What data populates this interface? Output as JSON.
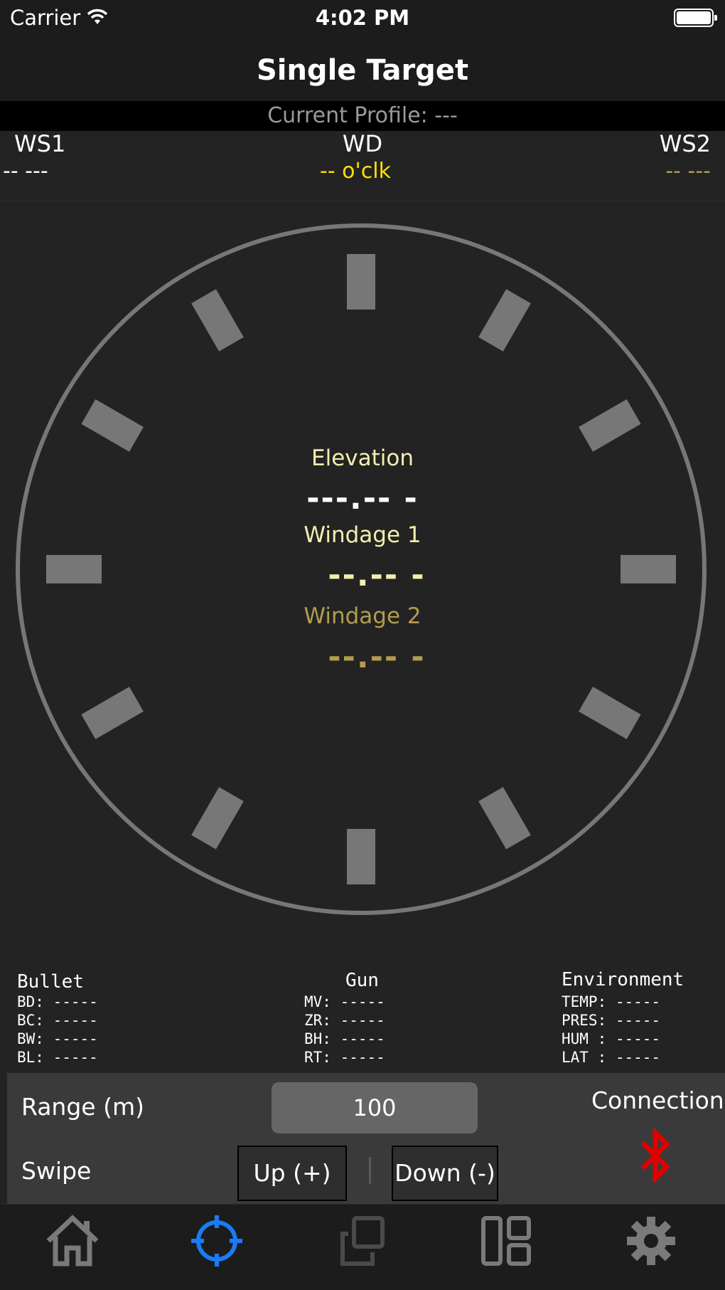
{
  "status": {
    "carrier": "Carrier",
    "time": "4:02 PM"
  },
  "nav": {
    "title": "Single Target"
  },
  "profile": {
    "text": "Current Profile: ---"
  },
  "wind": {
    "ws1_label": "WS1",
    "ws1_value": "-- ---",
    "wd_label": "WD",
    "wd_value": "-- o'clk",
    "ws2_label": "WS2",
    "ws2_value": "-- ---"
  },
  "readouts": {
    "elevation_label": "Elevation",
    "elevation_value": "---.-- -",
    "windage1_label": "Windage 1",
    "windage1_value": "--.-- -",
    "windage2_label": "Windage 2",
    "windage2_value": "--.-- -"
  },
  "info": {
    "bullet": {
      "title": "Bullet",
      "rows": [
        "BD: -----",
        "BC: -----",
        "BW: -----",
        "BL: -----"
      ]
    },
    "gun": {
      "title": "Gun",
      "rows": [
        "MV: -----",
        "ZR: -----",
        "BH: -----",
        "RT: -----"
      ]
    },
    "environment": {
      "title": "Environment",
      "rows": [
        "TEMP: -----",
        "PRES: -----",
        "HUM : -----",
        "LAT : -----"
      ]
    }
  },
  "controls": {
    "range_label": "Range (m)",
    "range_value": "100",
    "swipe_label": "Swipe",
    "up_label": "Up (+)",
    "down_label": "Down (-)",
    "connection_label": "Connection"
  },
  "tabs": [
    "home-icon",
    "crosshair-icon",
    "copy-icon",
    "layout-icon",
    "gear-icon"
  ],
  "colors": {
    "background": "#232323",
    "windage1": "#f3eeb0",
    "windage2": "#b49b4f",
    "wd_value": "#ffe000",
    "tab_active": "#1a7cf5",
    "tab_inactive": "#7a7a7a",
    "bluetooth": "#e00000"
  }
}
